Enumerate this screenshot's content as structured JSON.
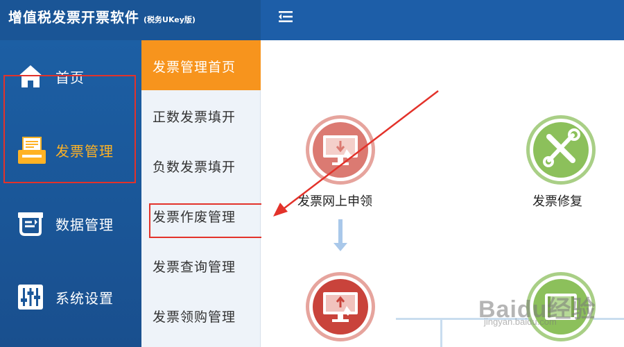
{
  "header": {
    "title": "增值税发票开票软件",
    "subtitle": "(税务UKey版)"
  },
  "nav": {
    "items": [
      {
        "label": "首页",
        "icon": "home-icon"
      },
      {
        "label": "发票管理",
        "icon": "invoice-printer-icon",
        "active": true
      },
      {
        "label": "数据管理",
        "icon": "data-management-icon"
      },
      {
        "label": "系统设置",
        "icon": "settings-sliders-icon"
      }
    ]
  },
  "submenu": {
    "items": [
      {
        "label": "发票管理首页",
        "active": true
      },
      {
        "label": "正数发票填开"
      },
      {
        "label": "负数发票填开"
      },
      {
        "label": "发票作废管理"
      },
      {
        "label": "发票查询管理"
      },
      {
        "label": "发票领购管理"
      }
    ]
  },
  "main": {
    "features": [
      {
        "label": "发票网上申领",
        "icon": "monitor-download-icon"
      },
      {
        "label": "发票修复",
        "icon": "wrench-screwdriver-icon"
      },
      {
        "label": "",
        "icon": "monitor-upload-icon"
      },
      {
        "label": "",
        "icon": "film-document-icon"
      }
    ]
  },
  "watermark": {
    "brand": "Baidu经验",
    "url": "jingyan.baidu.com"
  },
  "colors": {
    "header_blue": "#1d5ea8",
    "nav_blue": "#1a5596",
    "active_orange": "#f7941d",
    "active_nav_text": "#ffb224",
    "highlight_red": "#e3322a",
    "feature_red": "#d9675f",
    "feature_green": "#8cc05b"
  }
}
